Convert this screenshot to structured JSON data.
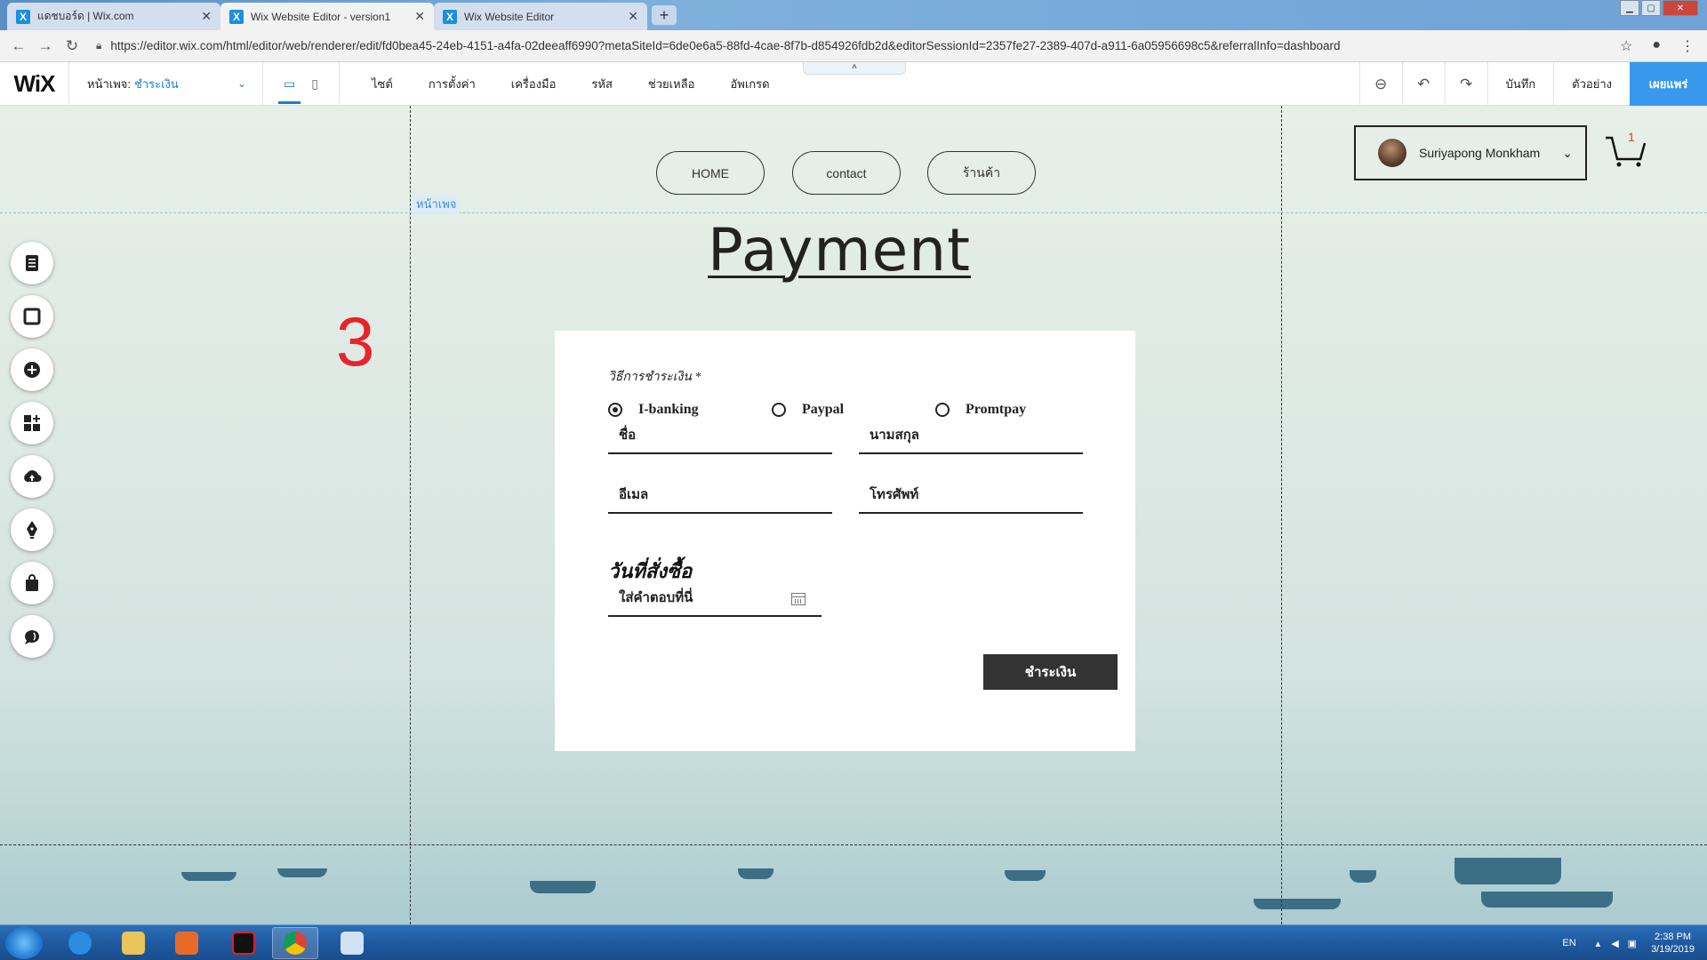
{
  "browser": {
    "tabs": [
      {
        "title": "แดชบอร์ด | Wix.com",
        "active": false
      },
      {
        "title": "Wix Website Editor - version1",
        "active": true
      },
      {
        "title": "Wix Website Editor",
        "active": false
      }
    ],
    "new_tab": "+",
    "url": "https://editor.wix.com/html/editor/web/renderer/edit/fd0bea45-24eb-4151-a4fa-02deeaff6990?metaSiteId=6de0e6a5-88fd-4cae-8f7b-d854926fdb2d&editorSessionId=2357fe27-2389-407d-a911-6a05956698c5&referralInfo=dashboard"
  },
  "editor": {
    "logo": "WiX",
    "page_label": "หน้าเพจ:",
    "page_value": "ชำระเงิน",
    "menus": [
      "ไซต์",
      "การตั้งค่า",
      "เครื่องมือ",
      "รหัส",
      "ช่วยเหลือ",
      "อัพเกรด"
    ],
    "save": "บันทึก",
    "preview": "ตัวอย่าง",
    "publish": "เผยแพร่"
  },
  "site": {
    "page_tag": "หน้าเพจ",
    "nav": [
      "HOME",
      "contact",
      "ร้านค้า"
    ],
    "member_name": "Suriyapong Monkham",
    "cart_count": "1",
    "title": "Payment",
    "annotation": "3",
    "form": {
      "method_label": "วิธีการชำระเงิน *",
      "methods": [
        "I-banking",
        "Paypal",
        "Promtpay"
      ],
      "selected_method": "I-banking",
      "first_name": "ชื่อ",
      "last_name": "นามสกุล",
      "email": "อีเมล",
      "phone": "โทรศัพท์",
      "date_heading": "วันที่สั่งซื้อ",
      "date_placeholder": "ใส่คำตอบที่นี่",
      "submit": "ชำระเงิน"
    }
  },
  "taskbar": {
    "lang": "EN",
    "time": "2:38 PM",
    "date": "3/19/2019"
  }
}
